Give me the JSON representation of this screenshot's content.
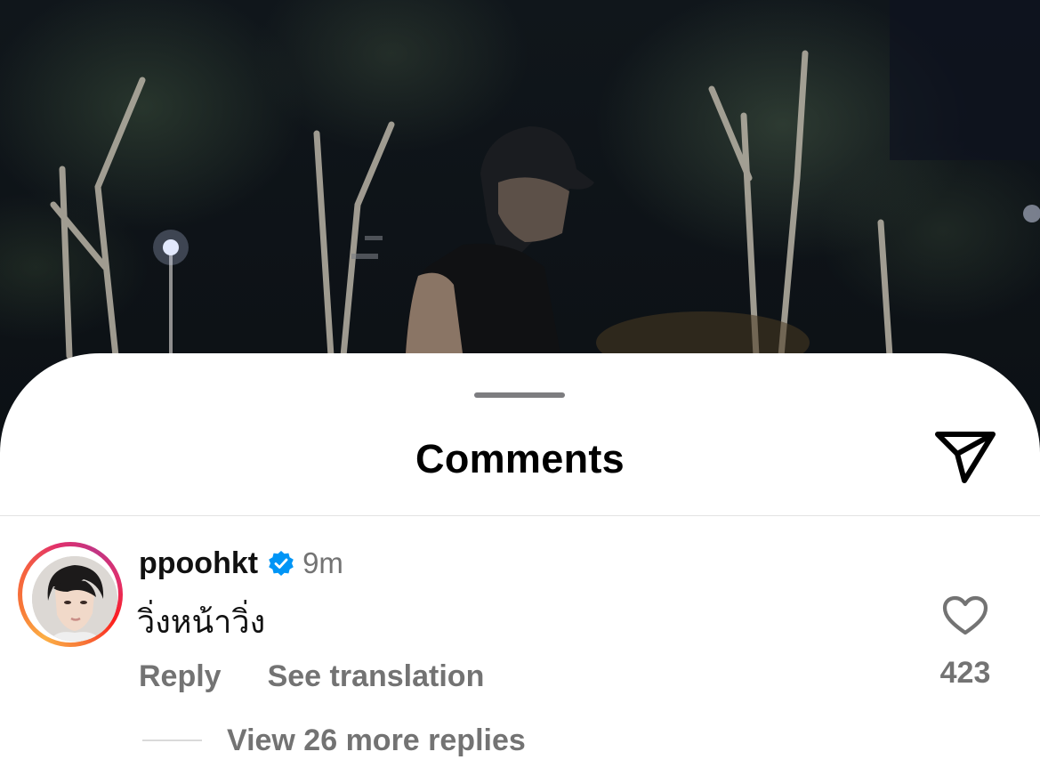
{
  "sheet": {
    "title": "Comments",
    "share_icon": "paper-plane-icon"
  },
  "comment": {
    "username": "ppoohkt",
    "verified_icon": "verified-badge-icon",
    "time": "9m",
    "text": "วิ่งหน้าวิ่ง",
    "reply_label": "Reply",
    "translate_label": "See translation",
    "like_icon": "heart-icon",
    "like_count": "423",
    "view_replies_label": "View 26 more replies",
    "avatar_story_ring": true
  },
  "colors": {
    "sheet_bg": "#ffffff",
    "title": "#000000",
    "secondary_text": "#737373",
    "verified": "#0095f6",
    "divider": "#e3e3e3"
  }
}
